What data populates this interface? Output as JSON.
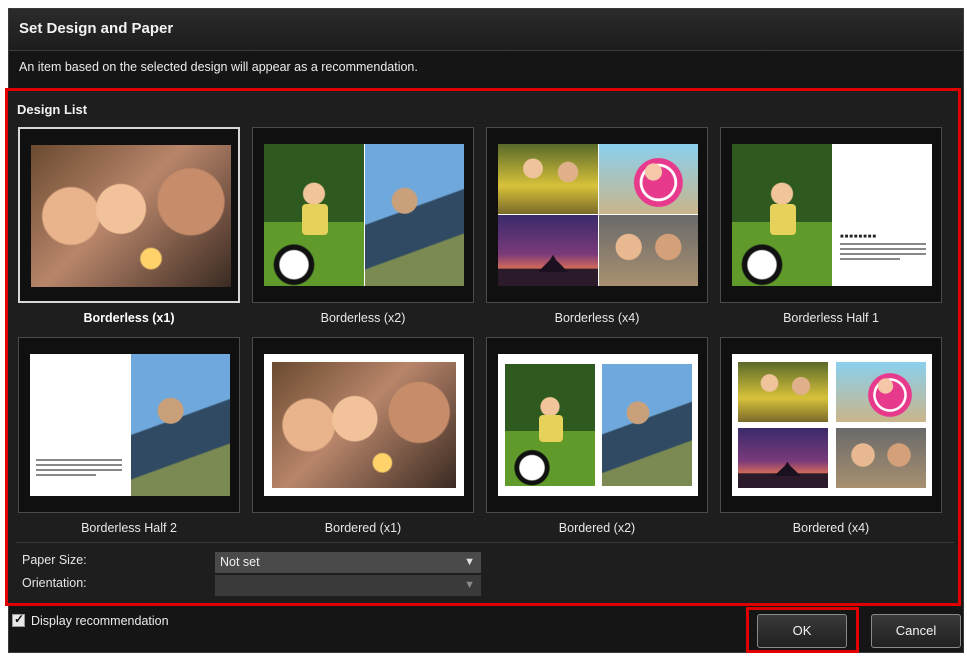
{
  "dialog": {
    "title": "Set Design and Paper",
    "subtitle": "An item based on the selected design will appear as a recommendation."
  },
  "design_list": {
    "label": "Design List",
    "items": [
      {
        "label": "Borderless (x1)",
        "selected": true
      },
      {
        "label": "Borderless (x2)",
        "selected": false
      },
      {
        "label": "Borderless (x4)",
        "selected": false
      },
      {
        "label": "Borderless Half 1",
        "selected": false
      },
      {
        "label": "Borderless Half 2",
        "selected": false
      },
      {
        "label": "Bordered (x1)",
        "selected": false
      },
      {
        "label": "Bordered (x2)",
        "selected": false
      },
      {
        "label": "Bordered (x4)",
        "selected": false
      }
    ]
  },
  "paper_settings": {
    "paper_size_label": "Paper Size:",
    "paper_size_value": "Not set",
    "orientation_label": "Orientation:",
    "orientation_value": ""
  },
  "footer": {
    "display_recommendation_label": "Display recommendation",
    "display_recommendation_checked": true,
    "ok_label": "OK",
    "cancel_label": "Cancel"
  },
  "colors": {
    "highlight": "#e00000",
    "background": "#151515"
  }
}
